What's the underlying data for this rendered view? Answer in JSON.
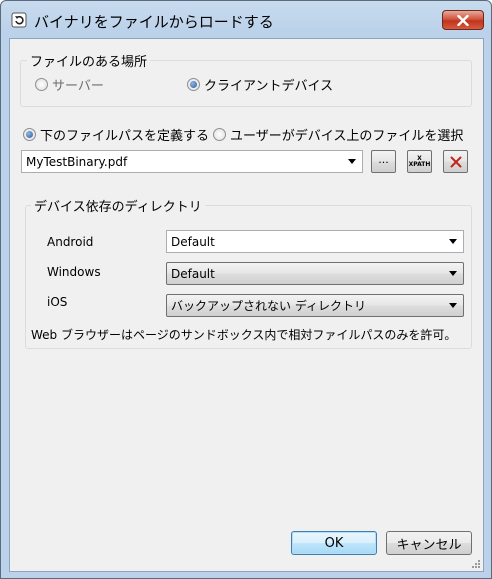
{
  "window": {
    "title": "バイナリをファイルからロードする"
  },
  "file_location": {
    "label": "ファイルのある場所",
    "options": [
      {
        "label": "サーバー",
        "selected": false
      },
      {
        "label": "クライアントデバイス",
        "selected": true
      }
    ]
  },
  "path_mode": {
    "options": [
      {
        "label": "下のファイルパスを定義する",
        "selected": true
      },
      {
        "label": "ユーザーがデバイス上のファイルを選択",
        "selected": false
      }
    ]
  },
  "file_path": {
    "value": "MyTestBinary.pdf",
    "browse_label": "...",
    "xpath_label": "XPATH"
  },
  "device_dirs": {
    "label": "デバイス依存のディレクトリ",
    "rows": [
      {
        "label": "Android",
        "value": "Default"
      },
      {
        "label": "Windows",
        "value": "Default"
      },
      {
        "label": "iOS",
        "value": "バックアップされない ディレクトリ"
      }
    ],
    "note": "Web ブラウザーはページのサンドボックス内で相対ファイルパスのみを許可。"
  },
  "buttons": {
    "ok": "OK",
    "cancel": "キャンセル"
  },
  "colors": {
    "close": "#c0341c",
    "delete_x": "#c0261e",
    "selected_radio": "#2a5a9c"
  }
}
